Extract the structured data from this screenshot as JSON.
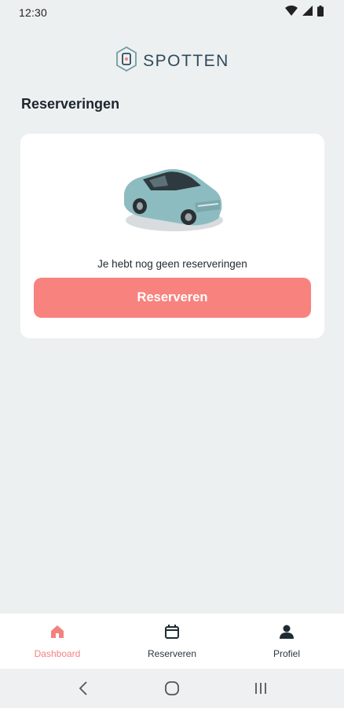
{
  "status_bar": {
    "time": "12:30",
    "icons": [
      "wifi-icon",
      "signal-icon",
      "battery-icon"
    ]
  },
  "header": {
    "logo_text": "SPOTTEN",
    "logo_icon": "spotten-logo-icon"
  },
  "page": {
    "section_title": "Reserveringen"
  },
  "empty_state": {
    "illustration": "car-illustration",
    "message": "Je hebt nog geen reserveringen",
    "button_label": "Reserveren"
  },
  "bottom_nav": {
    "items": [
      {
        "label": "Dashboard",
        "icon": "home-icon",
        "active": true
      },
      {
        "label": "Reserveren",
        "icon": "calendar-icon",
        "active": false
      },
      {
        "label": "Profiel",
        "icon": "person-icon",
        "active": false
      }
    ]
  },
  "system_nav": {
    "buttons": [
      "back-icon",
      "home-circle-icon",
      "recents-icon"
    ]
  },
  "colors": {
    "accent": "#f8827e",
    "background": "#edf0f1",
    "card": "#ffffff",
    "text": "#1d262c",
    "logo": "#2f4a5a"
  }
}
